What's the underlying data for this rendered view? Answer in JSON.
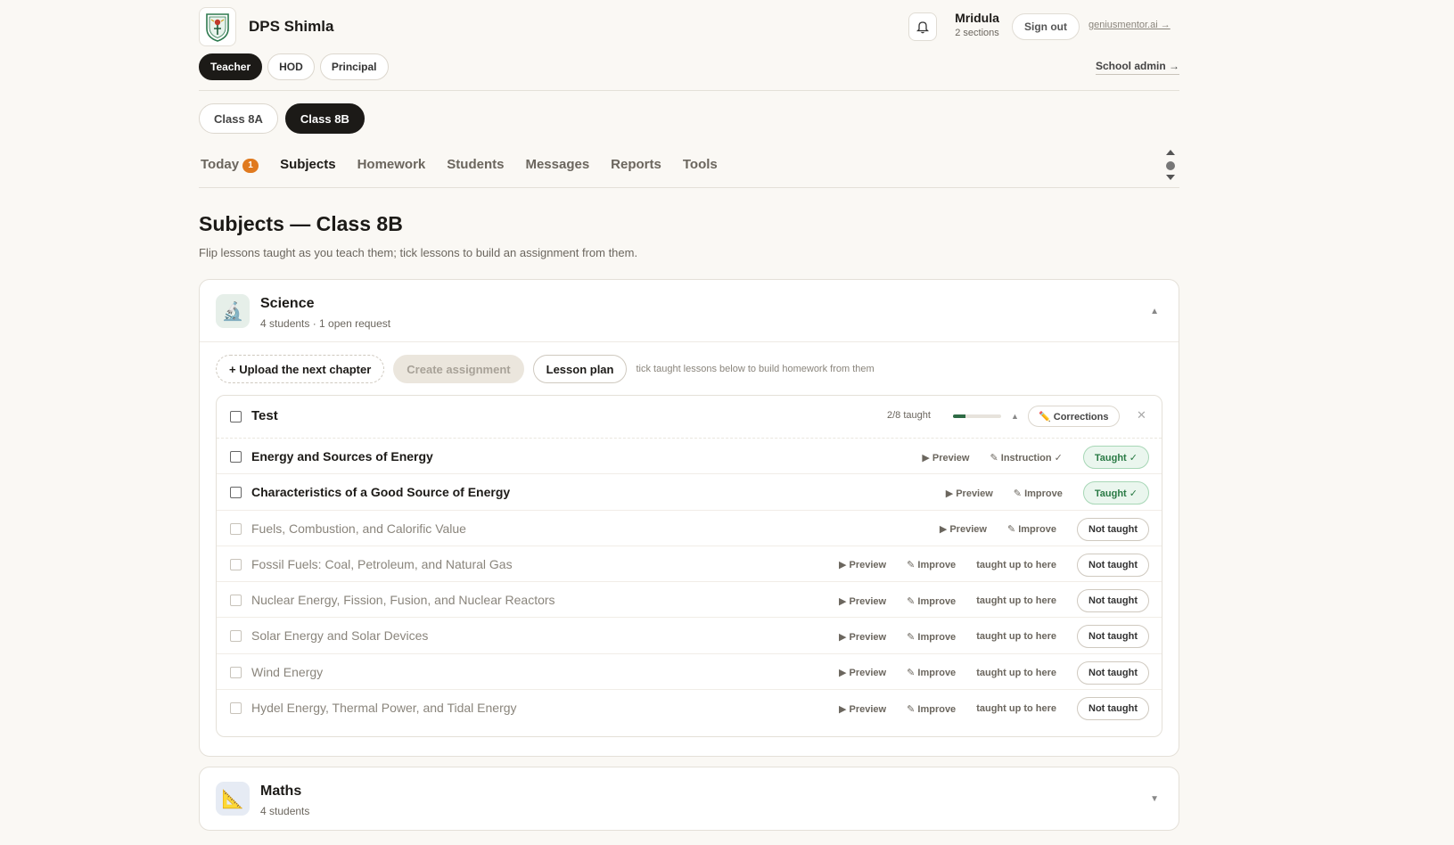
{
  "header": {
    "school_name": "DPS Shimla",
    "user_name": "Mridula",
    "user_sections": "2 sections",
    "sign_out": "Sign out",
    "site_link": "geniusmentor.ai →",
    "school_admin": "School admin →"
  },
  "roles": [
    "Teacher",
    "HOD",
    "Principal"
  ],
  "active_role": "Teacher",
  "classes": [
    "Class 8A",
    "Class 8B"
  ],
  "active_class": "Class 8B",
  "tabs": {
    "today": "Today",
    "today_badge": "1",
    "subjects": "Subjects",
    "homework": "Homework",
    "students": "Students",
    "messages": "Messages",
    "reports": "Reports",
    "tools": "Tools"
  },
  "page": {
    "title": "Subjects — Class 8B",
    "subtitle": "Flip lessons taught as you teach them; tick lessons to build an assignment from them."
  },
  "science": {
    "name": "Science",
    "meta": "4 students · 1 open request",
    "icon": "microscope-icon",
    "upload": "+ Upload the next chapter",
    "create_assignment": "Create assignment",
    "lesson_plan": "Lesson plan",
    "hint": "tick taught lessons below to build homework from them",
    "chapter": {
      "title": "Test",
      "progress_label": "2/8 taught",
      "progress_fraction": 0.25,
      "corrections": "✏️ Corrections",
      "lessons": [
        {
          "title": "Energy and Sources of Energy",
          "preview": "▶ Preview",
          "edit": "✎ Instruction ✓",
          "upto": "",
          "status": "Taught ✓",
          "taught": true
        },
        {
          "title": "Characteristics of a Good Source of Energy",
          "preview": "▶ Preview",
          "edit": "✎ Improve",
          "upto": "",
          "status": "Taught ✓",
          "taught": true
        },
        {
          "title": "Fuels, Combustion, and Calorific Value",
          "preview": "▶ Preview",
          "edit": "✎ Improve",
          "upto": "",
          "status": "Not taught",
          "taught": false
        },
        {
          "title": "Fossil Fuels: Coal, Petroleum, and Natural Gas",
          "preview": "▶ Preview",
          "edit": "✎ Improve",
          "upto": "taught up to here",
          "status": "Not taught",
          "taught": false
        },
        {
          "title": "Nuclear Energy, Fission, Fusion, and Nuclear Reactors",
          "preview": "▶ Preview",
          "edit": "✎ Improve",
          "upto": "taught up to here",
          "status": "Not taught",
          "taught": false
        },
        {
          "title": "Solar Energy and Solar Devices",
          "preview": "▶ Preview",
          "edit": "✎ Improve",
          "upto": "taught up to here",
          "status": "Not taught",
          "taught": false
        },
        {
          "title": "Wind Energy",
          "preview": "▶ Preview",
          "edit": "✎ Improve",
          "upto": "taught up to here",
          "status": "Not taught",
          "taught": false
        },
        {
          "title": "Hydel Energy, Thermal Power, and Tidal Energy",
          "preview": "▶ Preview",
          "edit": "✎ Improve",
          "upto": "taught up to here",
          "status": "Not taught",
          "taught": false
        }
      ]
    }
  },
  "maths": {
    "name": "Maths",
    "meta": "4 students",
    "icon": "set-square-icon"
  },
  "colors": {
    "accent_dark": "#1c1a17",
    "badge_orange": "#e07a1f",
    "taught_green": "#2a7a45",
    "background": "#faf8f4"
  }
}
